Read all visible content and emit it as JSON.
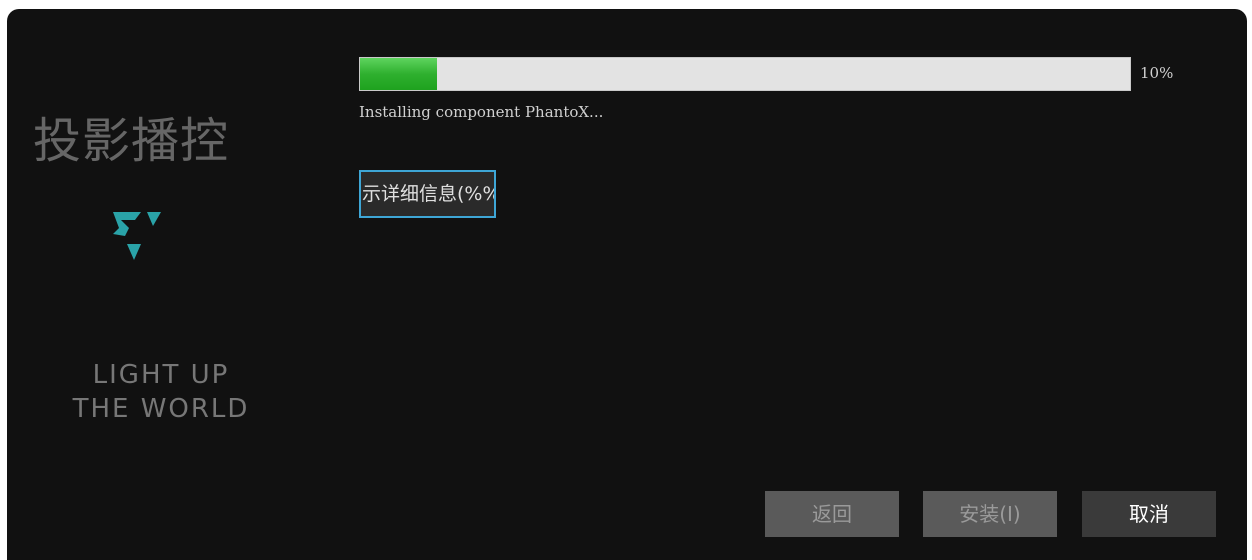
{
  "sidebar": {
    "app_title": "投影播控",
    "slogan_line1": "LIGHT UP",
    "slogan_line2": "THE WORLD",
    "logo_color": "#2aa3a8"
  },
  "progress": {
    "value": 0.1,
    "percent_label": "10%",
    "fill_color": "#2fb02f",
    "status": "Installing component PhantoX..."
  },
  "details": {
    "label": "示详细信息(%%"
  },
  "footer": {
    "back_label": "返回",
    "install_label": "安装(I)",
    "cancel_label": "取消"
  }
}
